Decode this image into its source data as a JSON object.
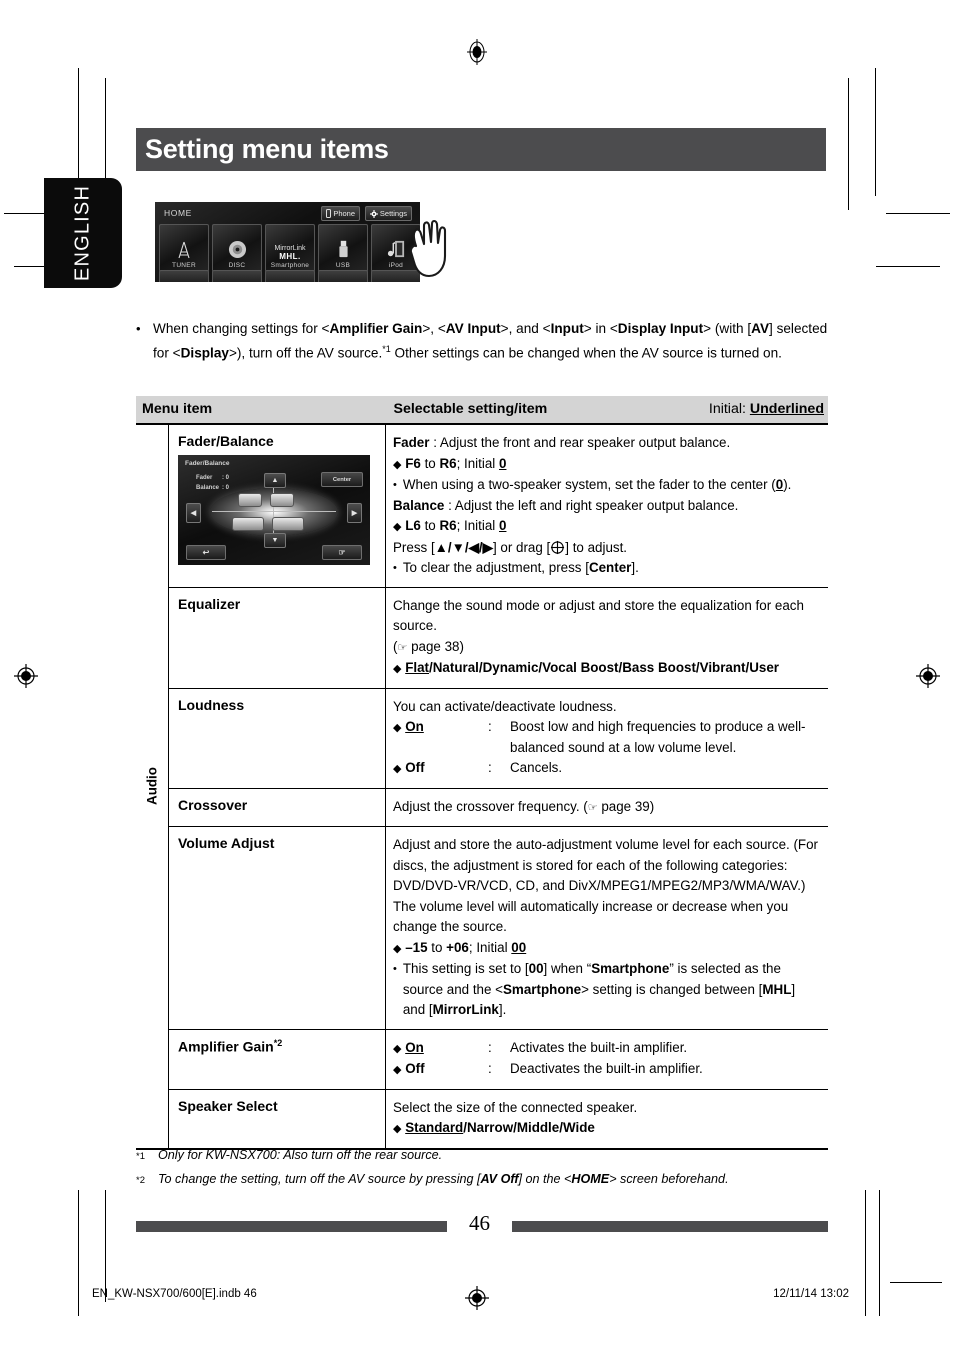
{
  "page": {
    "title": "Setting menu items",
    "language_tab": "ENGLISH",
    "page_number": "46",
    "slug_left": "EN_KW-NSX700/600[E].indb   46",
    "slug_right": "12/11/14   13:02"
  },
  "device_screenshot": {
    "home_label": "HOME",
    "phone_button": "Phone",
    "settings_button": "Settings",
    "sources": [
      {
        "label": "TUNER",
        "glyph": "ᴀ"
      },
      {
        "label": "DISC",
        "glyph": "◉"
      },
      {
        "label": "Smartphone",
        "line1": "MirrorLink",
        "line2": "MHL."
      },
      {
        "label": "USB",
        "glyph": "▮"
      },
      {
        "label": "iPod",
        "glyph": "♫"
      }
    ]
  },
  "intro": {
    "bullet": "•",
    "segments": [
      {
        "t": "When changing settings for <",
        "b": false
      },
      {
        "t": "Amplifier Gain",
        "b": true
      },
      {
        "t": ">, <",
        "b": false
      },
      {
        "t": "AV Input",
        "b": true
      },
      {
        "t": ">, and <",
        "b": false
      },
      {
        "t": "Input",
        "b": true
      },
      {
        "t": "> in <",
        "b": false
      },
      {
        "t": "Display Input",
        "b": true
      },
      {
        "t": "> (with [",
        "b": false
      },
      {
        "t": "AV",
        "b": true
      },
      {
        "t": "] selected for <",
        "b": false
      },
      {
        "t": "Display",
        "b": true
      },
      {
        "t": ">), turn off the AV source.",
        "b": false
      },
      {
        "t": "*1",
        "sup": true
      },
      {
        "t": " Other settings can be changed when the AV source is turned on.",
        "b": false
      }
    ]
  },
  "table": {
    "headers": {
      "menu_item": "Menu item",
      "selectable": "Selectable setting/item",
      "initial_prefix": "Initial: ",
      "initial_word": "Underlined"
    },
    "section_label": "Audio",
    "rows": [
      {
        "menu_item": "Fader/Balance",
        "has_image": true,
        "image": {
          "title": "Fader/Balance",
          "fader_label": "Fader",
          "fader_value": ": 0",
          "balance_label": "Balance",
          "balance_value": ": 0",
          "center_button": "Center"
        }
      },
      {
        "menu_item": "Equalizer"
      },
      {
        "menu_item": "Loudness"
      },
      {
        "menu_item": "Crossover"
      },
      {
        "menu_item": "Volume Adjust"
      },
      {
        "menu_item": "Amplifier Gain",
        "footnote": "*2"
      },
      {
        "menu_item": "Speaker Select"
      }
    ]
  },
  "content": {
    "fader_balance": {
      "l1_bold": "Fader",
      "l1_rest": " : Adjust the front and rear speaker output balance.",
      "l2_range_from": "F6",
      "l2_mid": " to ",
      "l2_range_to": "R6",
      "l2_initial": "; Initial ",
      "l2_value": "0",
      "l3": "When using a two-speaker system, set the fader to the center (",
      "l3_value": "0",
      "l3_end": ").",
      "l4_bold": "Balance",
      "l4_rest": " : Adjust the left and right speaker output balance.",
      "l5_range_from": "L6",
      "l5_mid": " to ",
      "l5_range_to": "R6",
      "l5_initial": "; Initial ",
      "l5_value": "0",
      "l6_a": "Press [",
      "l6_arrows": "▲/▼/◀/▶",
      "l6_b": "] or drag [",
      "l6_c": "] to adjust.",
      "l7_a": "To clear the adjustment, press [",
      "l7_bold": "Center",
      "l7_b": "]."
    },
    "equalizer": {
      "l1": "Change the sound mode or adjust and store the equalization for each source.",
      "l2_a": "(",
      "l2_icon": "☞",
      "l2_b": " page 38)",
      "options_underlined": "Flat",
      "options_rest": "/Natural/Dynamic/Vocal Boost/Bass Boost/Vibrant/User"
    },
    "loudness": {
      "l1": "You can activate/deactivate loudness.",
      "on_key": "On",
      "on_sep": ":",
      "on_val": "Boost low and high frequencies to produce a well-balanced sound at a low volume level.",
      "off_key": "Off",
      "off_sep": ":",
      "off_val": "Cancels."
    },
    "crossover": {
      "l1_a": "Adjust the crossover frequency. (",
      "l1_icon": "☞",
      "l1_b": " page 39)"
    },
    "volume_adjust": {
      "l1": "Adjust and store the auto-adjustment volume level for each source. (For discs, the adjustment is stored for each of the following categories: DVD/DVD-VR/VCD, CD, and DivX/MPEG1/MPEG2/MP3/WMA/WAV.) The volume level will automatically increase or decrease when you change the source.",
      "range_from": "–15",
      "range_mid": " to ",
      "range_to": "+06",
      "range_initial": "; Initial ",
      "range_value": "00",
      "note_a": "This setting is set to [",
      "note_b": "00",
      "note_c": "] when “",
      "note_d": "Smartphone",
      "note_e": "” is selected as the source and the <",
      "note_f": "Smartphone",
      "note_g": "> setting is changed between [",
      "note_h": "MHL",
      "note_i": "] and [",
      "note_j": "MirrorLink",
      "note_k": "]."
    },
    "amplifier_gain": {
      "on_key": "On",
      "on_sep": ":",
      "on_val": "Activates the built-in amplifier.",
      "off_key": "Off",
      "off_sep": ":",
      "off_val": "Deactivates the built-in amplifier."
    },
    "speaker_select": {
      "l1": "Select the size of the connected speaker.",
      "options_underlined": "Standard",
      "options_rest": "/Narrow/Middle/Wide"
    }
  },
  "footnotes": [
    {
      "marker": "*1",
      "segments": [
        {
          "t": "Only for KW-NSX700: Also turn off the rear source.",
          "b": false
        }
      ]
    },
    {
      "marker": "*2",
      "segments": [
        {
          "t": "To change the setting, turn off the AV source by pressing [",
          "b": false
        },
        {
          "t": "AV Off",
          "b": true
        },
        {
          "t": "] on the <",
          "b": false
        },
        {
          "t": "HOME",
          "b": true
        },
        {
          "t": "> screen beforehand.",
          "b": false
        }
      ]
    }
  ],
  "colors": {
    "banner": "#4c4c4e",
    "table_header": "#d4d4d4",
    "tab": "#0b0b0b"
  }
}
